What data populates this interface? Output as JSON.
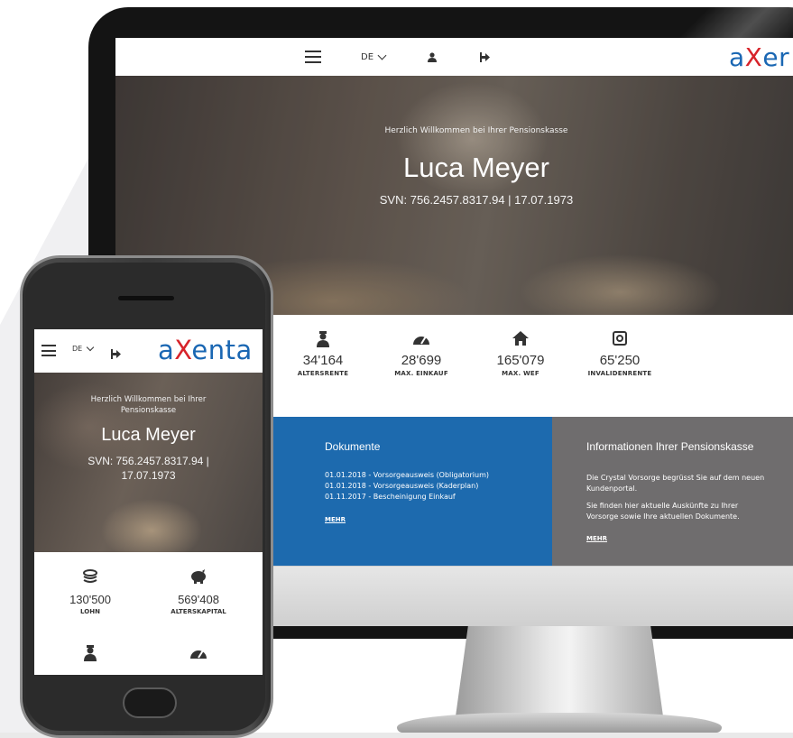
{
  "brand": {
    "logo_a": "a",
    "logo_x": "X",
    "logo_rest": "enta",
    "logo_cropped_rest": "er",
    "color_blue": "#1a67b3",
    "color_red": "#d7232a"
  },
  "nav": {
    "language": "DE",
    "menu_icon": "hamburger-icon",
    "user_icon": "user-icon",
    "logout_icon": "logout-icon"
  },
  "hero": {
    "welcome": "Herzlich Willkommen bei Ihrer Pensionskasse",
    "name": "Luca Meyer",
    "svn": "SVN: 756.2457.8317.94 | 17.07.1973",
    "svn_mobile_line1": "SVN: 756.2457.8317.94 |",
    "svn_mobile_line2": "17.07.1973",
    "welcome_mobile_line1": "Herzlich Willkommen bei Ihrer",
    "welcome_mobile_line2": "Pensionskasse"
  },
  "stats": [
    {
      "icon": "coins-icon",
      "value": "130'500",
      "label": "LOHN"
    },
    {
      "icon": "piggy-bank-icon",
      "value": "569'408",
      "label": "ALTERSKAPITAL"
    },
    {
      "icon": "retiree-icon",
      "value": "34'164",
      "label": "ALTERSRENTE"
    },
    {
      "icon": "speedometer-icon",
      "value": "28'699",
      "label": "MAX. EINKAUF"
    },
    {
      "icon": "home-icon",
      "value": "165'079",
      "label": "MAX. WEF"
    },
    {
      "icon": "lifebuoy-icon",
      "value": "65'250",
      "label": "INVALIDENRENTE"
    }
  ],
  "documents": {
    "title": "Dokumente",
    "items": [
      "01.01.2018 - Vorsorgeausweis (Obligatorium)",
      "01.01.2018 - Vorsorgeausweis (Kaderplan)",
      "01.11.2017 - Bescheinigung Einkauf"
    ],
    "more": "MEHR",
    "color": "#1d6aae"
  },
  "info": {
    "title": "Informationen Ihrer Pensionskasse",
    "line1": "Die Crystal Vorsorge begrüsst Sie auf dem neuen",
    "line2": "Kundenportal.",
    "line3": "Sie finden hier aktuelle Auskünfte zu Ihrer",
    "line4": "Vorsorge sowie Ihre aktuellen Dokumente.",
    "more": "MEHR",
    "color": "#6f6d6e"
  }
}
